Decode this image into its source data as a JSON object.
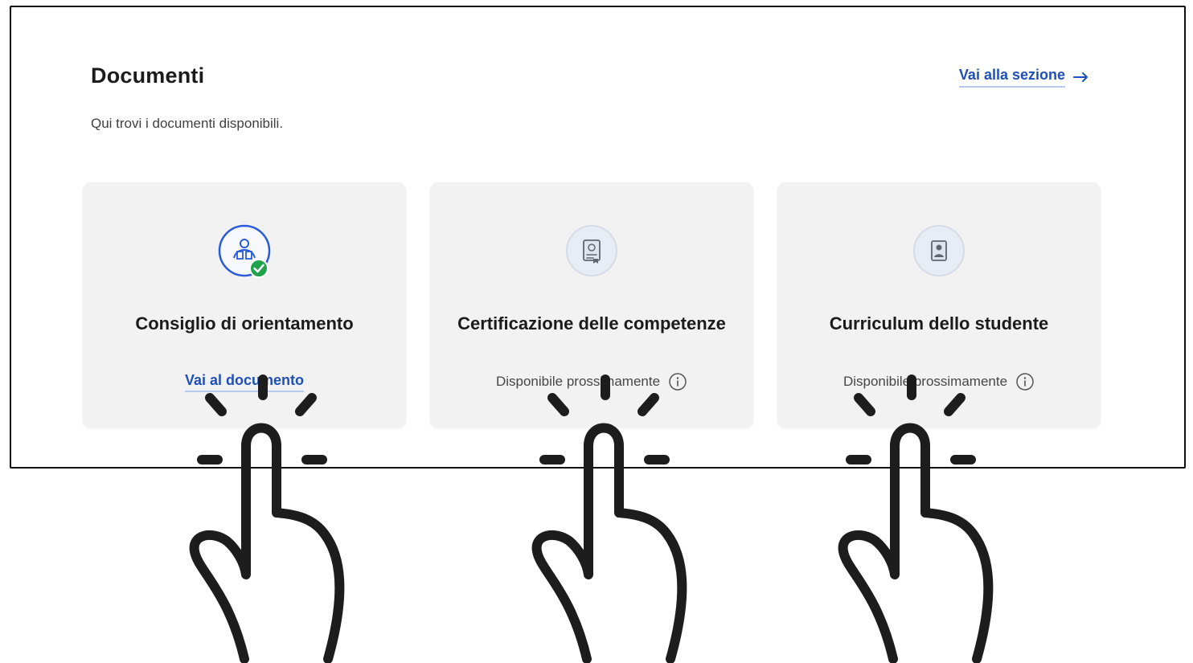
{
  "section": {
    "title": "Documenti",
    "subtitle": "Qui trovi i documenti disponibili.",
    "link_label": "Vai alla sezione"
  },
  "cards": [
    {
      "title": "Consiglio di orientamento",
      "action_label": "Vai al documento",
      "icon": "orientation-document-icon",
      "status": "available"
    },
    {
      "title": "Certificazione delle competenze",
      "status_label": "Disponibile prossimamente",
      "icon": "certification-document-icon",
      "status": "coming-soon"
    },
    {
      "title": "Curriculum dello studente",
      "status_label": "Disponibile prossimamente",
      "icon": "curriculum-document-icon",
      "status": "coming-soon"
    }
  ],
  "colors": {
    "link": "#1f4fb8",
    "card_background": "#f2f2f3",
    "success": "#1fa34a",
    "hand_overlay": "#1d1d1d"
  }
}
